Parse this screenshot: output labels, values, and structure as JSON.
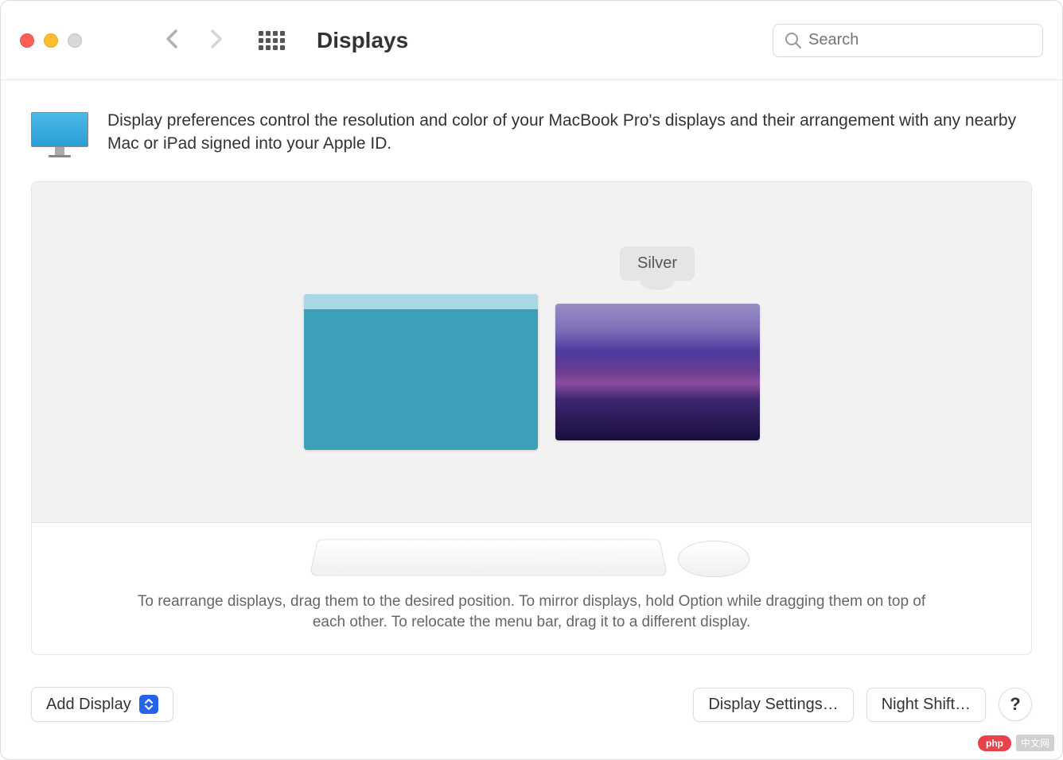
{
  "toolbar": {
    "title": "Displays",
    "search_placeholder": "Search"
  },
  "intro": {
    "text": "Display preferences control the resolution and color of your MacBook Pro's displays and their arrangement with any nearby Mac or iPad signed into your Apple ID."
  },
  "arrangement": {
    "tooltip_label": "Silver"
  },
  "hint": {
    "text": "To rearrange displays, drag them to the desired position. To mirror displays, hold Option while dragging them on top of each other. To relocate the menu bar, drag it to a different display."
  },
  "footer": {
    "add_display": "Add Display",
    "display_settings": "Display Settings…",
    "night_shift": "Night Shift…",
    "help": "?"
  },
  "watermark": {
    "badge": "php",
    "text": "中文网"
  }
}
